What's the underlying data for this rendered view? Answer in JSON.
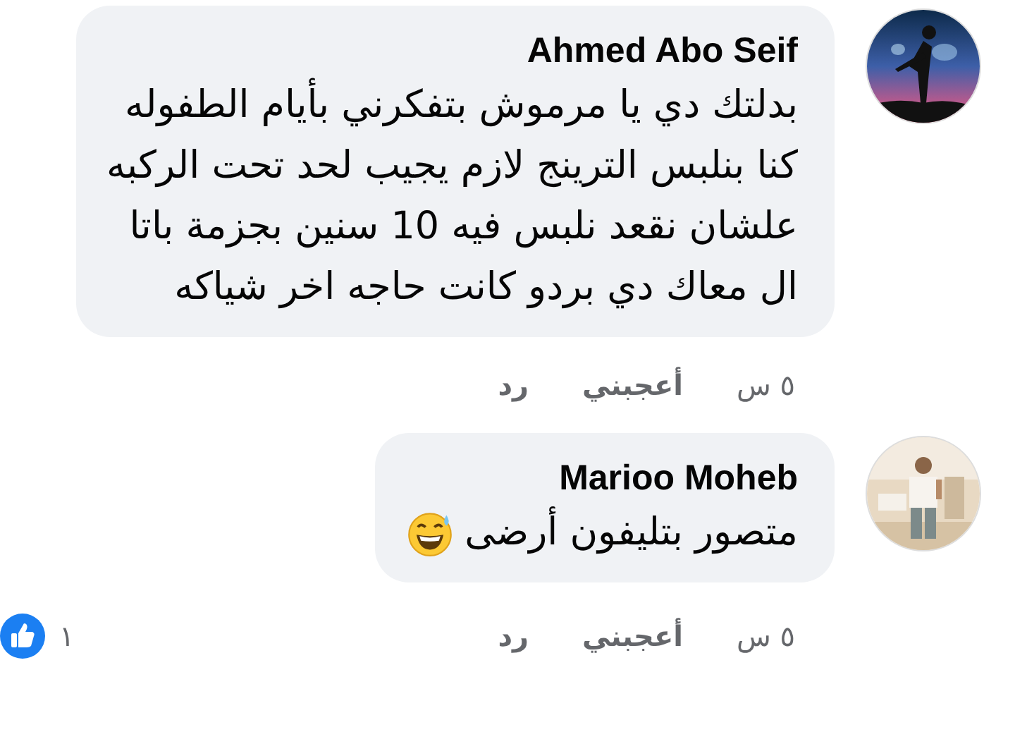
{
  "comments": [
    {
      "author": "Ahmed Abo Seif",
      "body": "بدلتك دي يا مرموش بتفكرني بأيام الطفوله\nكنا بنلبس الترينج لازم يجيب لحد تحت الركبه\nعلشان نقعد نلبس فيه 10 سنين بجزمة باتا\nال معاك دي بردو كانت حاجه اخر شياكه",
      "has_emoji": false,
      "time": "٥ س",
      "like_label": "أعجبني",
      "reply_label": "رد"
    },
    {
      "author": "Marioo Moheb",
      "body": "متصور بتليفون أرضى",
      "has_emoji": true,
      "time": "٥ س",
      "like_label": "أعجبني",
      "reply_label": "رد",
      "reaction_count": "١"
    }
  ]
}
